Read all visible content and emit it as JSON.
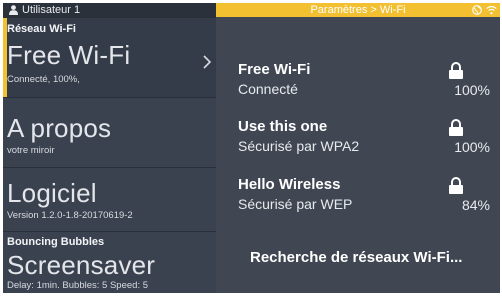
{
  "user_bar": {
    "label": "Utilisateur 1",
    "icon": "user-icon"
  },
  "menu": {
    "wifi": {
      "title": "Réseau Wi-Fi",
      "big": "Free Wi-Fi",
      "sub": "Connecté, 100%,",
      "icon": "chevron-right-icon"
    },
    "about": {
      "big": "A propos",
      "sub": "votre miroir"
    },
    "software": {
      "big": "Logiciel",
      "sub": "Version 1.2.0-1.8-20170619-2"
    },
    "screensaver": {
      "title": "Bouncing Bubbles",
      "big": "Screensaver",
      "sub": "Delay: 1min.  Bubbles: 5  Speed: 5"
    }
  },
  "title_bar": {
    "title": "Paramètres > Wi-Fi",
    "icons": [
      "globe-icon",
      "wifi-icon"
    ]
  },
  "networks": [
    {
      "name": "Free Wi-Fi",
      "status": "Connecté",
      "signal": "100%",
      "icon": "lock-icon"
    },
    {
      "name": "Use this one",
      "status": "Sécurisé par WPA2",
      "signal": "100%",
      "icon": "lock-icon"
    },
    {
      "name": "Hello Wireless",
      "status": "Sécurisé par WEP",
      "signal": "84%",
      "icon": "lock-icon"
    }
  ],
  "scan_label": "Recherche de réseaux Wi-Fi...",
  "colors": {
    "accent": "#f2c031",
    "sidebar": "#3a4250",
    "panel": "#404753"
  }
}
